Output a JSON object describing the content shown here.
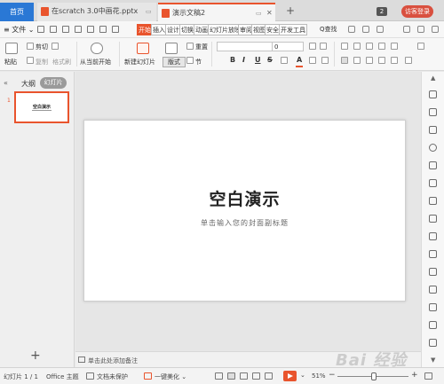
{
  "tabs": {
    "home": "首页",
    "doc1": "在scratch 3.0中画花.pptx",
    "doc2": "演示文稿2",
    "add": "+",
    "badge": "2",
    "login": "访客登录"
  },
  "menu": {
    "file": "≡ 文件 ⌄",
    "tabs": [
      "开始",
      "插入",
      "设计",
      "切换",
      "动画",
      "幻灯片放映",
      "审阅",
      "视图",
      "安全",
      "开发工具"
    ],
    "active_tab": "开始",
    "search": "Q查找"
  },
  "ribbon": {
    "paste": "粘贴",
    "cut": "剪切",
    "copy": "复制",
    "format_painter": "格式刷",
    "from_current": "从当前开始",
    "new_slide": "新建幻灯片",
    "layout": "版式",
    "reset": "重置",
    "section": "节",
    "font_size": "0",
    "bold": "B",
    "italic": "I",
    "underline": "U",
    "strike": "S",
    "font_color": "A"
  },
  "left_panel": {
    "outline_tab": "大纲",
    "slides_tab": "幻灯片",
    "thumb_number": "1",
    "thumb_title": "空白演示",
    "add_slide": "+"
  },
  "slide": {
    "title": "空白演示",
    "subtitle": "单击输入您的封面副标题"
  },
  "notes": {
    "placeholder": "单击此处添加备注"
  },
  "status": {
    "slide_count": "幻灯片 1 / 1",
    "theme": "Office 主题",
    "protect": "文档未保护",
    "beautify": "一键美化 ⌄",
    "zoom": "51%",
    "zoom_fraction": 0.51
  },
  "watermark": "Bai 经验",
  "colors": {
    "accent": "#e9542d",
    "home_tab": "#2a78d5",
    "login": "#d9503f"
  }
}
